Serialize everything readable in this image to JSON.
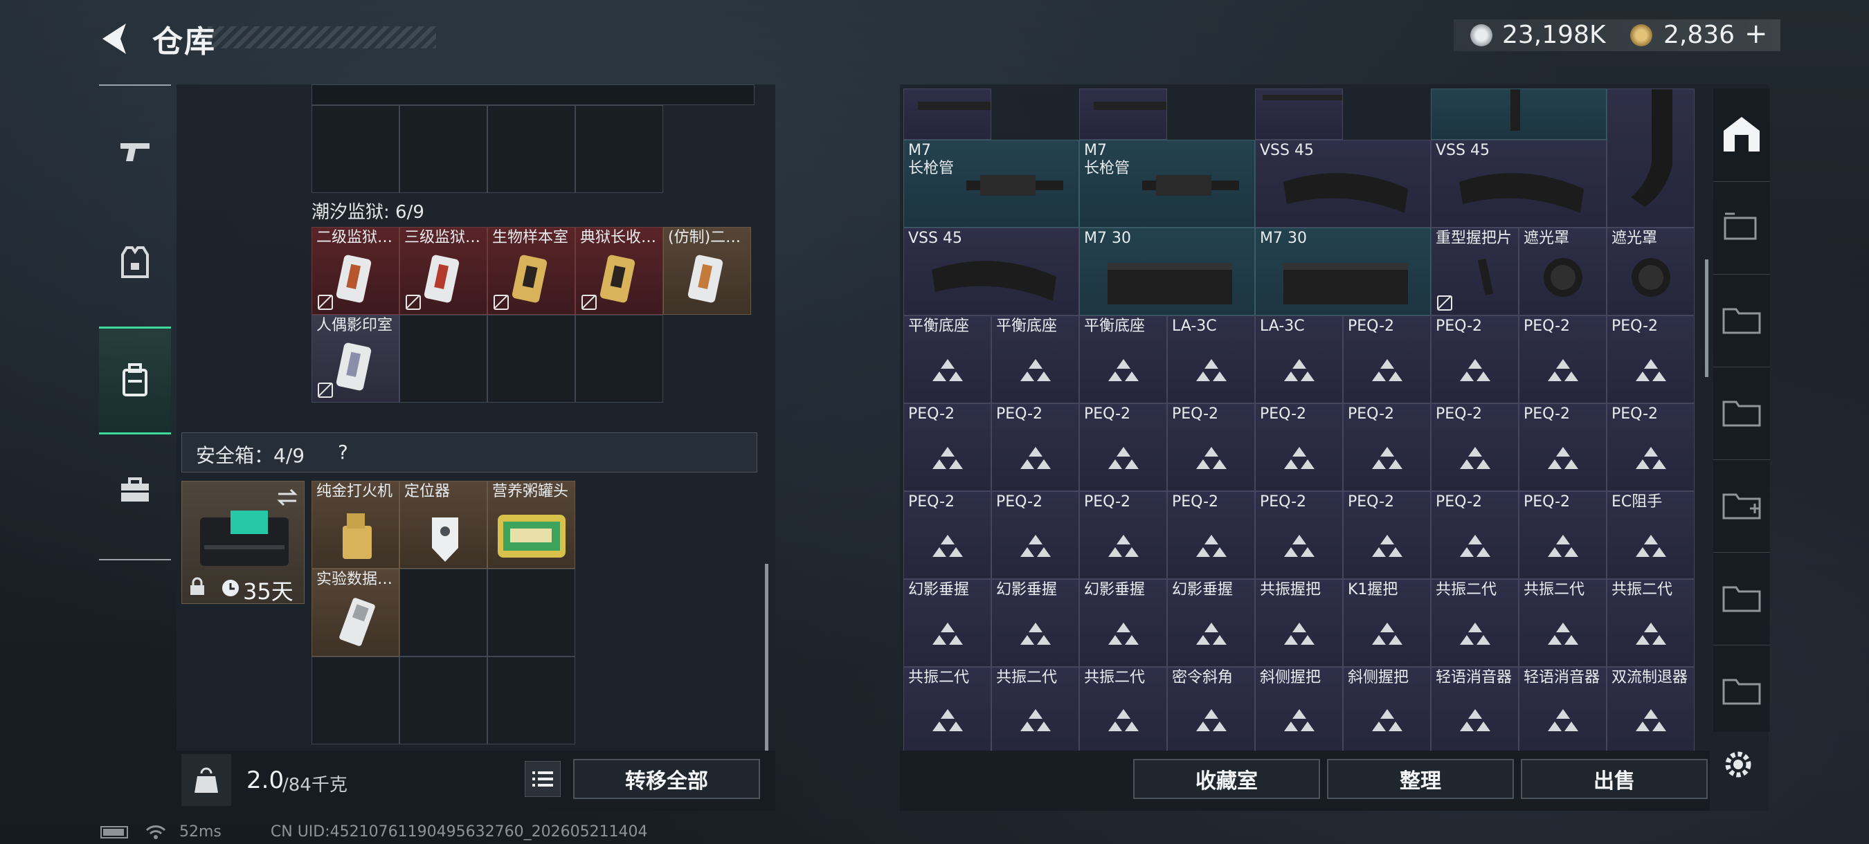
{
  "header": {
    "title": "仓库",
    "currency_silver": "23,198K",
    "currency_gold": "2,836",
    "add_label": "+"
  },
  "left": {
    "section_prison": "潮汐监狱: 6/9",
    "prison_items": [
      "二级监狱…",
      "三级监狱…",
      "生物样本室",
      "典狱长收…",
      "(仿制)二…",
      "人偶影印室"
    ],
    "secure_box_label": "安全箱：4/9",
    "help_mark": "?",
    "box_timer": "35天",
    "secure_items": [
      "纯金打火机",
      "定位器",
      "营养粥罐头",
      "实验数据…"
    ],
    "weight_value": "2.0",
    "weight_capacity": "/84千克",
    "transfer_all": "转移全部"
  },
  "right": {
    "row_mag": [
      {
        "name": "M7",
        "sub": "长枪管"
      },
      {
        "name": "M7",
        "sub": "长枪管"
      },
      {
        "name": "VSS 45",
        "sub": ""
      },
      {
        "name": "VSS 45",
        "sub": ""
      }
    ],
    "row_mag2": [
      {
        "name": "VSS 45"
      },
      {
        "name": "M7 30"
      },
      {
        "name": "M7 30"
      },
      {
        "name": "重型握把片"
      },
      {
        "name": "遮光罩"
      },
      {
        "name": "遮光罩"
      }
    ],
    "grid_rows": [
      [
        "平衡底座",
        "平衡底座",
        "平衡底座",
        "LA-3C",
        "LA-3C",
        "PEQ-2",
        "PEQ-2",
        "PEQ-2",
        "PEQ-2"
      ],
      [
        "PEQ-2",
        "PEQ-2",
        "PEQ-2",
        "PEQ-2",
        "PEQ-2",
        "PEQ-2",
        "PEQ-2",
        "PEQ-2",
        "PEQ-2"
      ],
      [
        "PEQ-2",
        "PEQ-2",
        "PEQ-2",
        "PEQ-2",
        "PEQ-2",
        "PEQ-2",
        "PEQ-2",
        "PEQ-2",
        "EC阻手"
      ],
      [
        "幻影垂握",
        "幻影垂握",
        "幻影垂握",
        "幻影垂握",
        "共振握把",
        "K1握把",
        "共振二代",
        "共振二代",
        "共振二代"
      ],
      [
        "共振二代",
        "共振二代",
        "共振二代",
        "密令斜角",
        "斜侧握把",
        "斜侧握把",
        "轻语消音器",
        "轻语消音器",
        "双流制退器"
      ]
    ],
    "btn_collection": "收藏室",
    "btn_sort": "整理",
    "btn_sell": "出售"
  },
  "status": {
    "ping": "52ms",
    "uid": "CN UID:452107611904956327​60_202605211404"
  },
  "colors": {
    "accent": "#3ddc9a",
    "red_item": "#5a2428",
    "brown_item": "#574637",
    "blue_item": "#23424e",
    "purple_item": "#2e2f48"
  }
}
